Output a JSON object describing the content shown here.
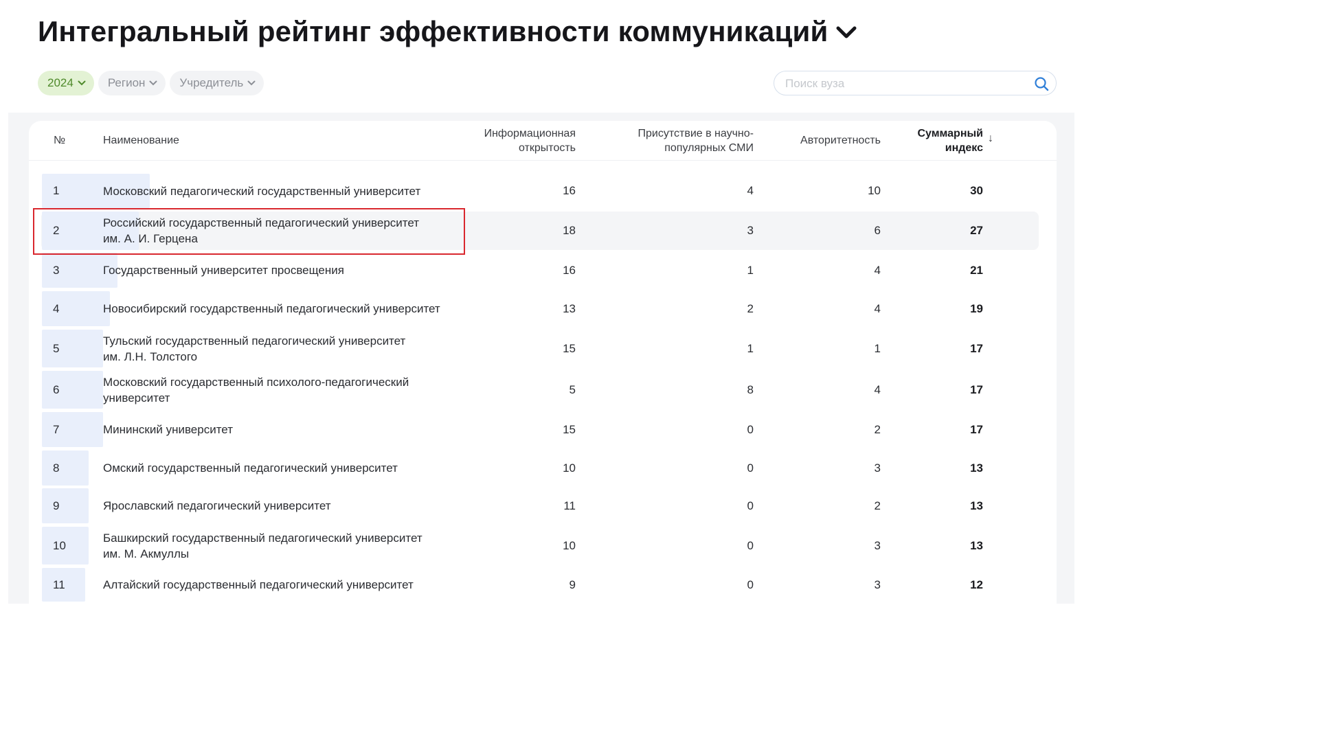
{
  "page": {
    "title": "Интегральный рейтинг эффективности коммуникаций"
  },
  "filters": [
    {
      "label": "2024",
      "active": true
    },
    {
      "label": "Регион",
      "active": false
    },
    {
      "label": "Учредитель",
      "active": false
    }
  ],
  "search": {
    "placeholder": "Поиск вуза",
    "value": ""
  },
  "table": {
    "headers": {
      "rank": "№",
      "name": "Наименование",
      "col1_l1": "Информационная",
      "col1_l2": "открытость",
      "col2_l1": "Присутствие в научно-",
      "col2_l2": "популярных СМИ",
      "col3": "Авторитетность",
      "col4_l1": "Суммарный",
      "col4_l2": "индекс",
      "sort_indicator": "↓"
    },
    "rows": [
      {
        "rank": "1",
        "name": [
          "Московский педагогический государственный университет"
        ],
        "info": "16",
        "media": "4",
        "auth": "10",
        "total": "30",
        "bar_fraction": 1.0
      },
      {
        "rank": "2",
        "name": [
          "Российский государственный педагогический университет",
          "им. А. И. Герцена"
        ],
        "info": "18",
        "media": "3",
        "auth": "6",
        "total": "27",
        "bar_fraction": 0.9
      },
      {
        "rank": "3",
        "name": [
          "Государственный университет просвещения"
        ],
        "info": "16",
        "media": "1",
        "auth": "4",
        "total": "21",
        "bar_fraction": 0.7
      },
      {
        "rank": "4",
        "name": [
          "Новосибирский государственный педагогический университет"
        ],
        "info": "13",
        "media": "2",
        "auth": "4",
        "total": "19",
        "bar_fraction": 0.633
      },
      {
        "rank": "5",
        "name": [
          "Тульский государственный педагогический университет",
          "им. Л.Н. Толстого"
        ],
        "info": "15",
        "media": "1",
        "auth": "1",
        "total": "17",
        "bar_fraction": 0.567
      },
      {
        "rank": "6",
        "name": [
          "Московский государственный психолого-педагогический",
          "университет"
        ],
        "info": "5",
        "media": "8",
        "auth": "4",
        "total": "17",
        "bar_fraction": 0.567
      },
      {
        "rank": "7",
        "name": [
          "Мининский университет"
        ],
        "info": "15",
        "media": "0",
        "auth": "2",
        "total": "17",
        "bar_fraction": 0.567
      },
      {
        "rank": "8",
        "name": [
          "Омский государственный педагогический университет"
        ],
        "info": "10",
        "media": "0",
        "auth": "3",
        "total": "13",
        "bar_fraction": 0.433
      },
      {
        "rank": "9",
        "name": [
          "Ярославский педагогический университет"
        ],
        "info": "11",
        "media": "0",
        "auth": "2",
        "total": "13",
        "bar_fraction": 0.433
      },
      {
        "rank": "10",
        "name": [
          "Башкирский государственный педагогический университет",
          "им. М. Акмуллы"
        ],
        "info": "10",
        "media": "0",
        "auth": "3",
        "total": "13",
        "bar_fraction": 0.433
      },
      {
        "rank": "11",
        "name": [
          "Алтайский государственный педагогический университет"
        ],
        "info": "9",
        "media": "0",
        "auth": "3",
        "total": "12",
        "bar_fraction": 0.4
      }
    ],
    "highlighted_row_rank": "2"
  },
  "colors": {
    "active_chip_bg": "#e3f2d4",
    "active_chip_text": "#4f8a2b",
    "rank_bar": "#e9effb",
    "search_icon": "#2f7fd8",
    "annotation_box": "#d9272e"
  },
  "icons": {
    "title_dropdown": "chevron-down-icon",
    "chip_dropdown": "chevron-down-icon",
    "search": "search-icon"
  }
}
